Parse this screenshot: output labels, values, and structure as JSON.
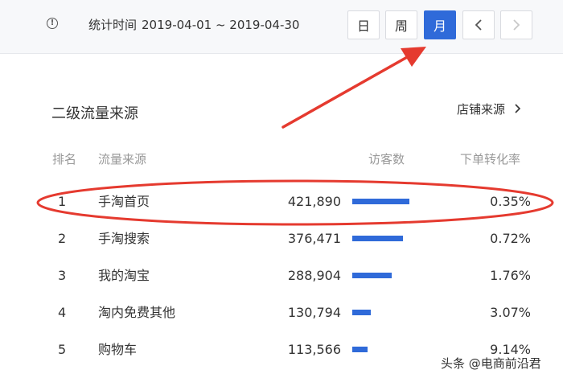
{
  "header": {
    "stat_label": "统计时间",
    "date_range": "2019-04-01 ~ 2019-04-30",
    "buttons": {
      "day": "日",
      "week": "周",
      "month": "月",
      "prev": "‹",
      "next": "›"
    },
    "active_period": "month",
    "accent_color": "#2f6ad9"
  },
  "section": {
    "title": "二级流量来源",
    "link_label": "店铺来源",
    "link_arrow": "›"
  },
  "table": {
    "headers": {
      "rank": "排名",
      "source": "流量来源",
      "visitors": "访客数",
      "conversion": "下单转化率"
    },
    "rows": [
      {
        "rank": "1",
        "source": "手淘首页",
        "visitors": "421,890",
        "bar_fraction": 0.71,
        "conversion": "0.35%"
      },
      {
        "rank": "2",
        "source": "手淘搜索",
        "visitors": "376,471",
        "bar_fraction": 0.63,
        "conversion": "0.72%"
      },
      {
        "rank": "3",
        "source": "我的淘宝",
        "visitors": "288,904",
        "bar_fraction": 0.49,
        "conversion": "1.76%"
      },
      {
        "rank": "4",
        "source": "淘内免费其他",
        "visitors": "130,794",
        "bar_fraction": 0.23,
        "conversion": "3.07%"
      },
      {
        "rank": "5",
        "source": "购物车",
        "visitors": "113,566",
        "bar_fraction": 0.19,
        "conversion": "9.14%"
      }
    ]
  },
  "annotation": {
    "color": "#e53a2f"
  },
  "watermark": "头条 @电商前沿君"
}
